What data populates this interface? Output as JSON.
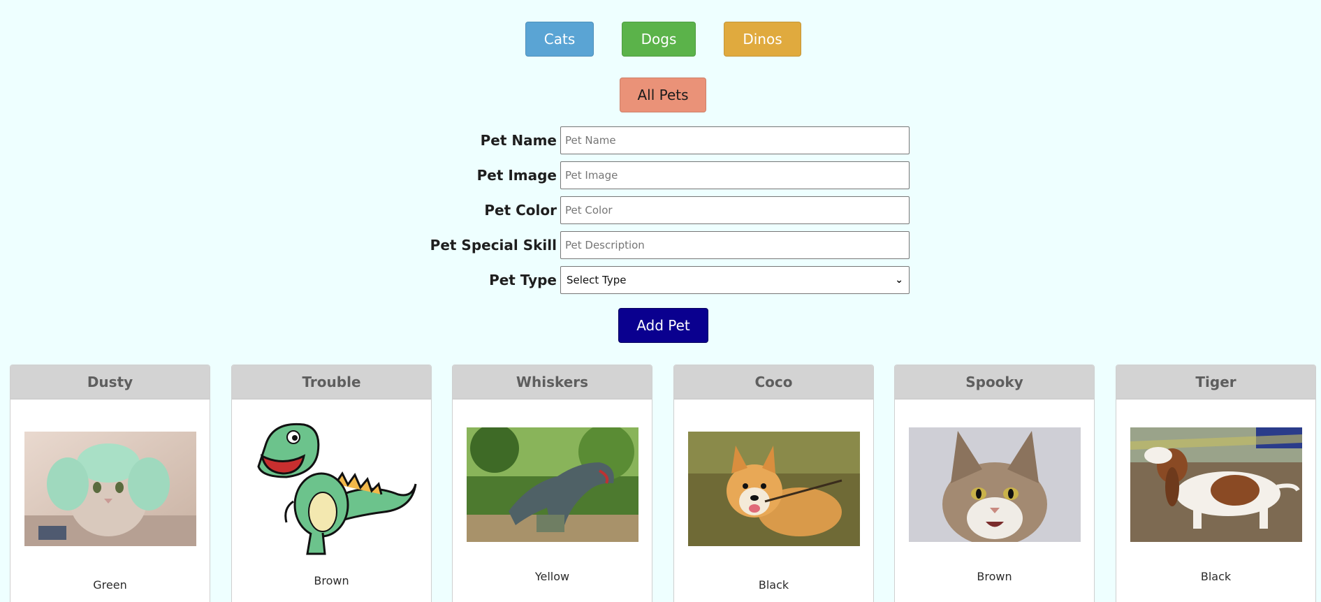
{
  "filters": {
    "cats_label": "Cats",
    "dogs_label": "Dogs",
    "dinos_label": "Dinos",
    "all_label": "All Pets"
  },
  "form": {
    "name_label": "Pet Name",
    "name_placeholder": "Pet Name",
    "image_label": "Pet Image",
    "image_placeholder": "Pet Image",
    "color_label": "Pet Color",
    "color_placeholder": "Pet Color",
    "skill_label": "Pet Special Skill",
    "skill_placeholder": "Pet Description",
    "type_label": "Pet Type",
    "type_selected": "Select Type",
    "submit_label": "Add Pet"
  },
  "colors": {
    "background": "#eeffff",
    "cats_button": "#5aa4d4",
    "dogs_button": "#5bb34a",
    "dinos_button": "#e0aa3e",
    "all_button": "#ea9278",
    "add_button": "#0a008f",
    "card_header": "#d3d3d3"
  },
  "pets": [
    {
      "name": "Dusty",
      "color": "Green",
      "image_icon": "cat-with-towel-photo"
    },
    {
      "name": "Trouble",
      "color": "Brown",
      "image_icon": "cartoon-dinosaur"
    },
    {
      "name": "Whiskers",
      "color": "Yellow",
      "image_icon": "dinosaur-statue-photo"
    },
    {
      "name": "Coco",
      "color": "Black",
      "image_icon": "corgi-photo"
    },
    {
      "name": "Spooky",
      "color": "Brown",
      "image_icon": "maine-coon-photo"
    },
    {
      "name": "Tiger",
      "color": "Black",
      "image_icon": "basset-hound-photo"
    }
  ]
}
